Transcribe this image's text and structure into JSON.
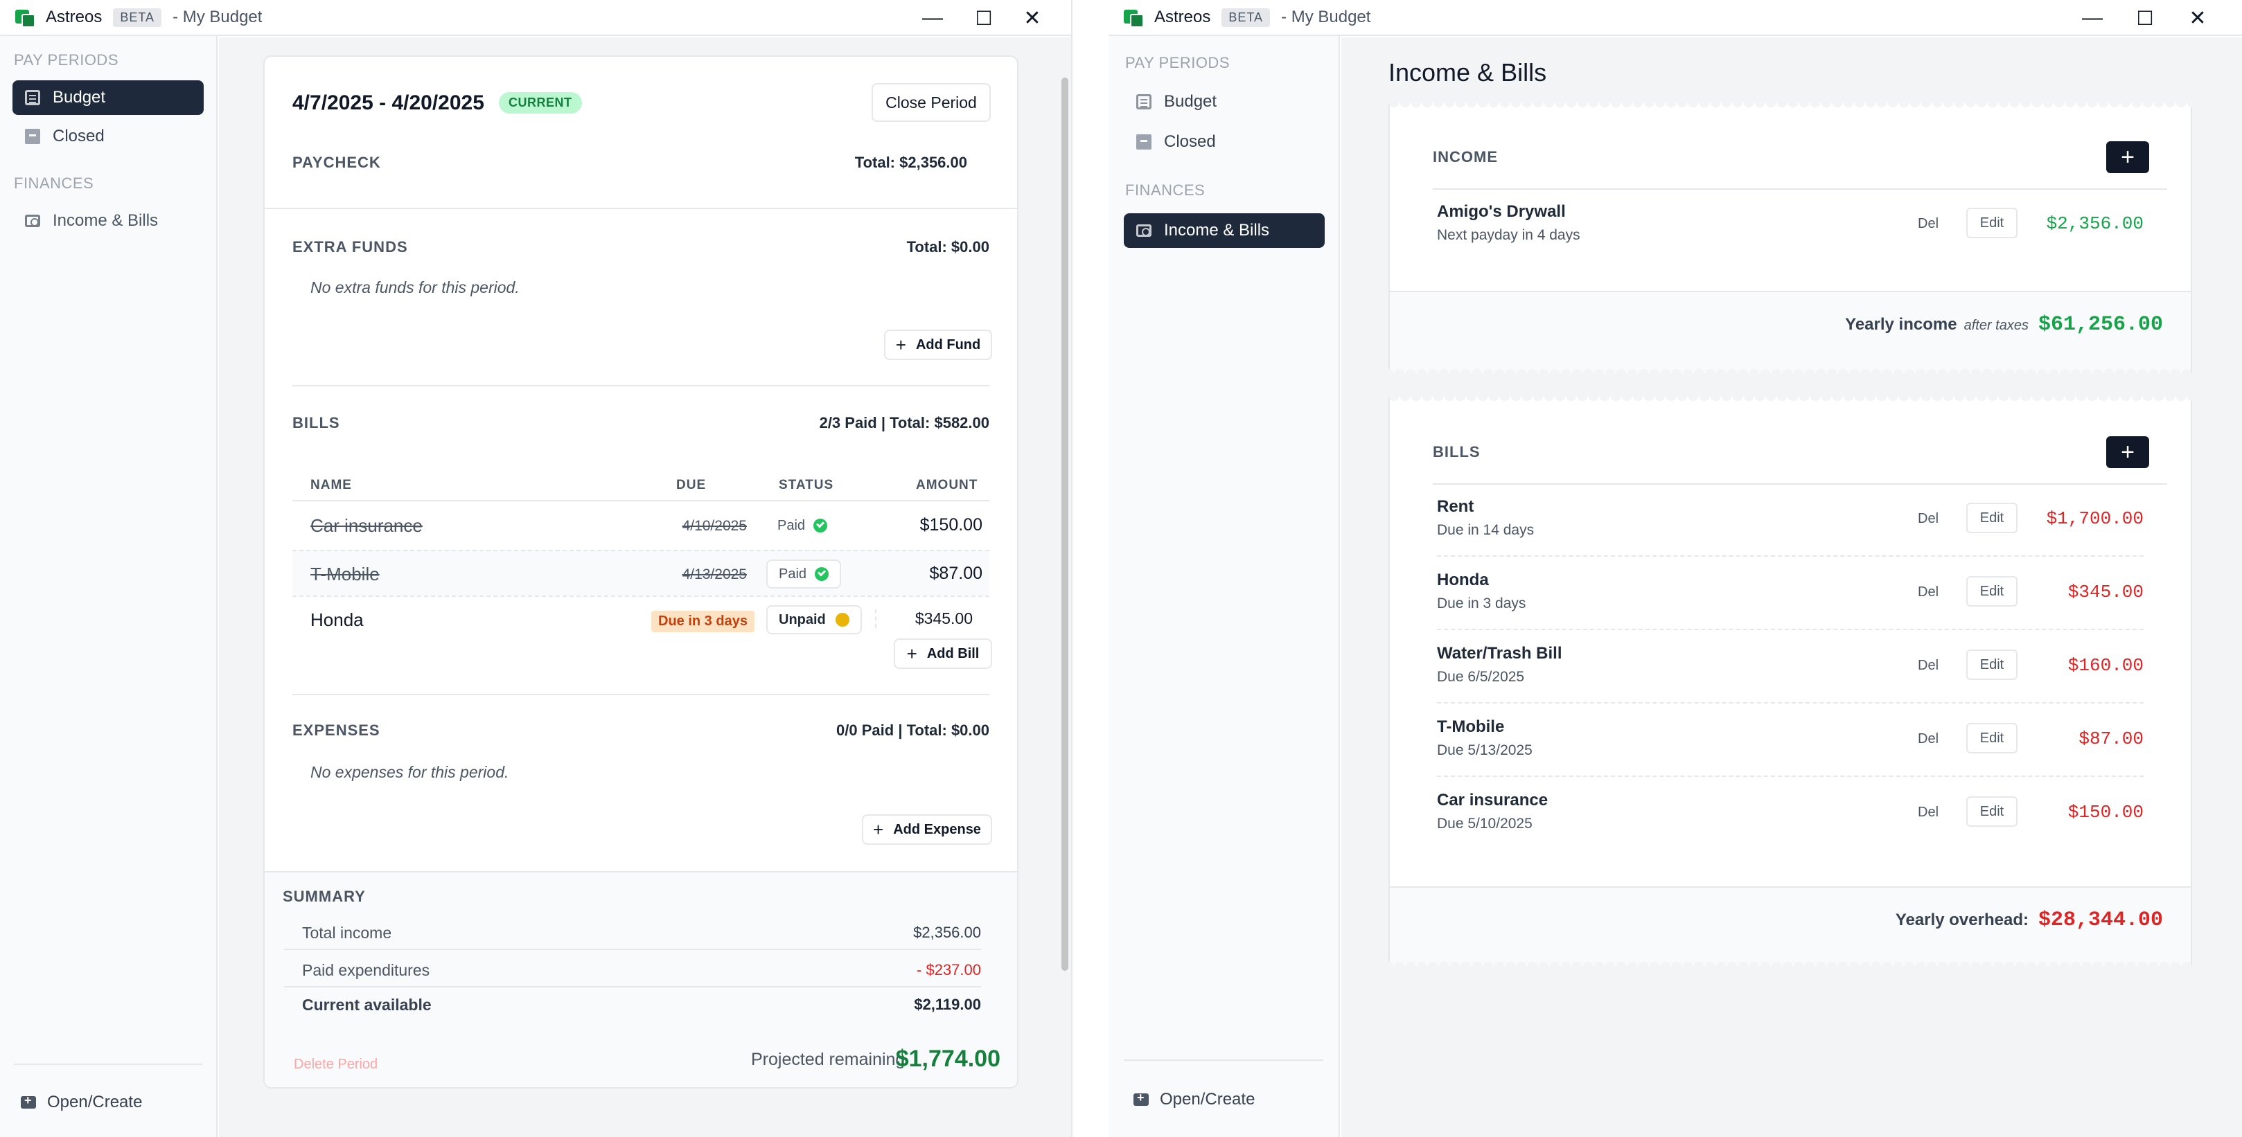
{
  "colors": {
    "accent_dark": "#1e293b",
    "income_green": "#16a34a",
    "bill_red": "#dc2626",
    "current_green": "#15803d"
  },
  "window_a": {
    "title": {
      "app": "Astreos",
      "badge": "BETA",
      "doc": "- My Budget"
    },
    "controls": {
      "minimize": "—",
      "maximize": "☐",
      "close": "✕"
    },
    "sidebar": {
      "section_pay_periods": "PAY PERIODS",
      "items_pay": [
        {
          "label": "Budget",
          "icon": "document-icon",
          "active": true
        },
        {
          "label": "Closed",
          "icon": "archive-icon"
        }
      ],
      "section_finances": "FINANCES",
      "items_fin": [
        {
          "label": "Income & Bills",
          "icon": "money-icon"
        }
      ],
      "open_create": "Open/Create"
    },
    "period": {
      "range": "4/7/2025 - 4/20/2025",
      "badge": "CURRENT",
      "close_button": "Close Period",
      "paycheck": {
        "header": "PAYCHECK",
        "total": "Total: $2,356.00"
      },
      "extra_funds": {
        "header": "EXTRA FUNDS",
        "total": "Total: $0.00",
        "empty": "No extra funds for this period.",
        "add_button": "Add Fund"
      },
      "bills": {
        "header": "BILLS",
        "total": "2/3 Paid | Total: $582.00",
        "columns": {
          "name": "NAME",
          "due": "DUE",
          "status": "STATUS",
          "amount": "AMOUNT"
        },
        "rows": [
          {
            "name": "Car insurance",
            "due": "4/10/2025",
            "status": "Paid",
            "amount": "$150.00"
          },
          {
            "name": "T-Mobile",
            "due": "4/13/2025",
            "status": "Paid",
            "amount": "$87.00"
          },
          {
            "name": "Honda",
            "due": "Due in 3 days",
            "status": "Unpaid",
            "amount": "$345.00"
          }
        ],
        "add_button": "Add Bill"
      },
      "expenses": {
        "header": "EXPENSES",
        "total": "0/0 Paid | Total: $0.00",
        "empty": "No expenses for this period.",
        "add_button": "Add Expense"
      },
      "summary": {
        "header": "SUMMARY",
        "rows": [
          {
            "label": "Total income",
            "value": "$2,356.00"
          },
          {
            "label": "Paid expenditures",
            "value": "- $237.00"
          },
          {
            "label": "Current available",
            "value": "$2,119.00"
          }
        ],
        "delete": "Delete Period",
        "projected_label": "Projected remaining",
        "projected_value": "$1,774.00"
      }
    }
  },
  "window_b": {
    "title": {
      "app": "Astreos",
      "badge": "BETA",
      "doc": "- My Budget"
    },
    "controls": {
      "minimize": "—",
      "maximize": "☐",
      "close": "✕"
    },
    "sidebar": {
      "section_pay_periods": "PAY PERIODS",
      "items_pay": [
        {
          "label": "Budget",
          "icon": "document-icon"
        },
        {
          "label": "Closed",
          "icon": "archive-icon"
        }
      ],
      "section_finances": "FINANCES",
      "items_fin": [
        {
          "label": "Income & Bills",
          "icon": "money-icon",
          "active": true
        }
      ],
      "open_create": "Open/Create"
    },
    "page_title": "Income & Bills",
    "income": {
      "header": "INCOME",
      "add_label": "+",
      "items": [
        {
          "name": "Amigo's Drywall",
          "sub": "Next payday in 4 days",
          "del": "Del",
          "edit": "Edit",
          "amount": "$2,356.00"
        }
      ],
      "footer_label": "Yearly income",
      "footer_note": "after taxes",
      "footer_value": "$61,256.00"
    },
    "bills": {
      "header": "BILLS",
      "add_label": "+",
      "items": [
        {
          "name": "Rent",
          "sub": "Due in 14 days",
          "del": "Del",
          "edit": "Edit",
          "amount": "$1,700.00"
        },
        {
          "name": "Honda",
          "sub": "Due in 3 days",
          "del": "Del",
          "edit": "Edit",
          "amount": "$345.00"
        },
        {
          "name": "Water/Trash Bill",
          "sub": "Due 6/5/2025",
          "del": "Del",
          "edit": "Edit",
          "amount": "$160.00"
        },
        {
          "name": "T-Mobile",
          "sub": "Due 5/13/2025",
          "del": "Del",
          "edit": "Edit",
          "amount": "$87.00"
        },
        {
          "name": "Car insurance",
          "sub": "Due 5/10/2025",
          "del": "Del",
          "edit": "Edit",
          "amount": "$150.00"
        }
      ],
      "footer_label": "Yearly overhead:",
      "footer_value": "$28,344.00"
    }
  }
}
